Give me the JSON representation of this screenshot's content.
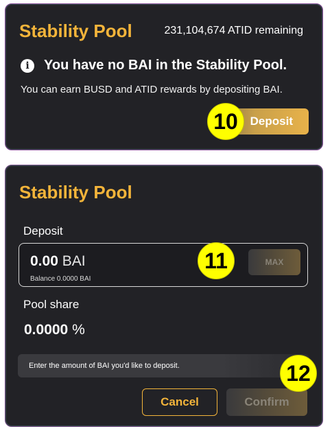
{
  "overview": {
    "title": "Stability Pool",
    "remaining": "231,104,674 ATID remaining",
    "info_icon": "info-icon",
    "heading": "You have no BAI in the Stability Pool.",
    "description": "You can earn BUSD and ATID rewards by depositing BAI.",
    "deposit_button": "Deposit"
  },
  "deposit_form": {
    "title": "Stability Pool",
    "deposit_label": "Deposit",
    "amount_value": "0.00",
    "amount_unit": "BAI",
    "balance": "Balance 0.0000 BAI",
    "max_button": "MAX",
    "pool_share_label": "Pool share",
    "pool_share_value": "0.0000",
    "pool_share_unit": "%",
    "hint": "Enter the amount of BAI you'd like to deposit.",
    "cancel_button": "Cancel",
    "confirm_button": "Confirm"
  },
  "step_badges": [
    "10",
    "11",
    "12"
  ],
  "colors": {
    "accent": "#f3b43a",
    "panel_bg": "#222226",
    "badge": "#ffff00"
  }
}
